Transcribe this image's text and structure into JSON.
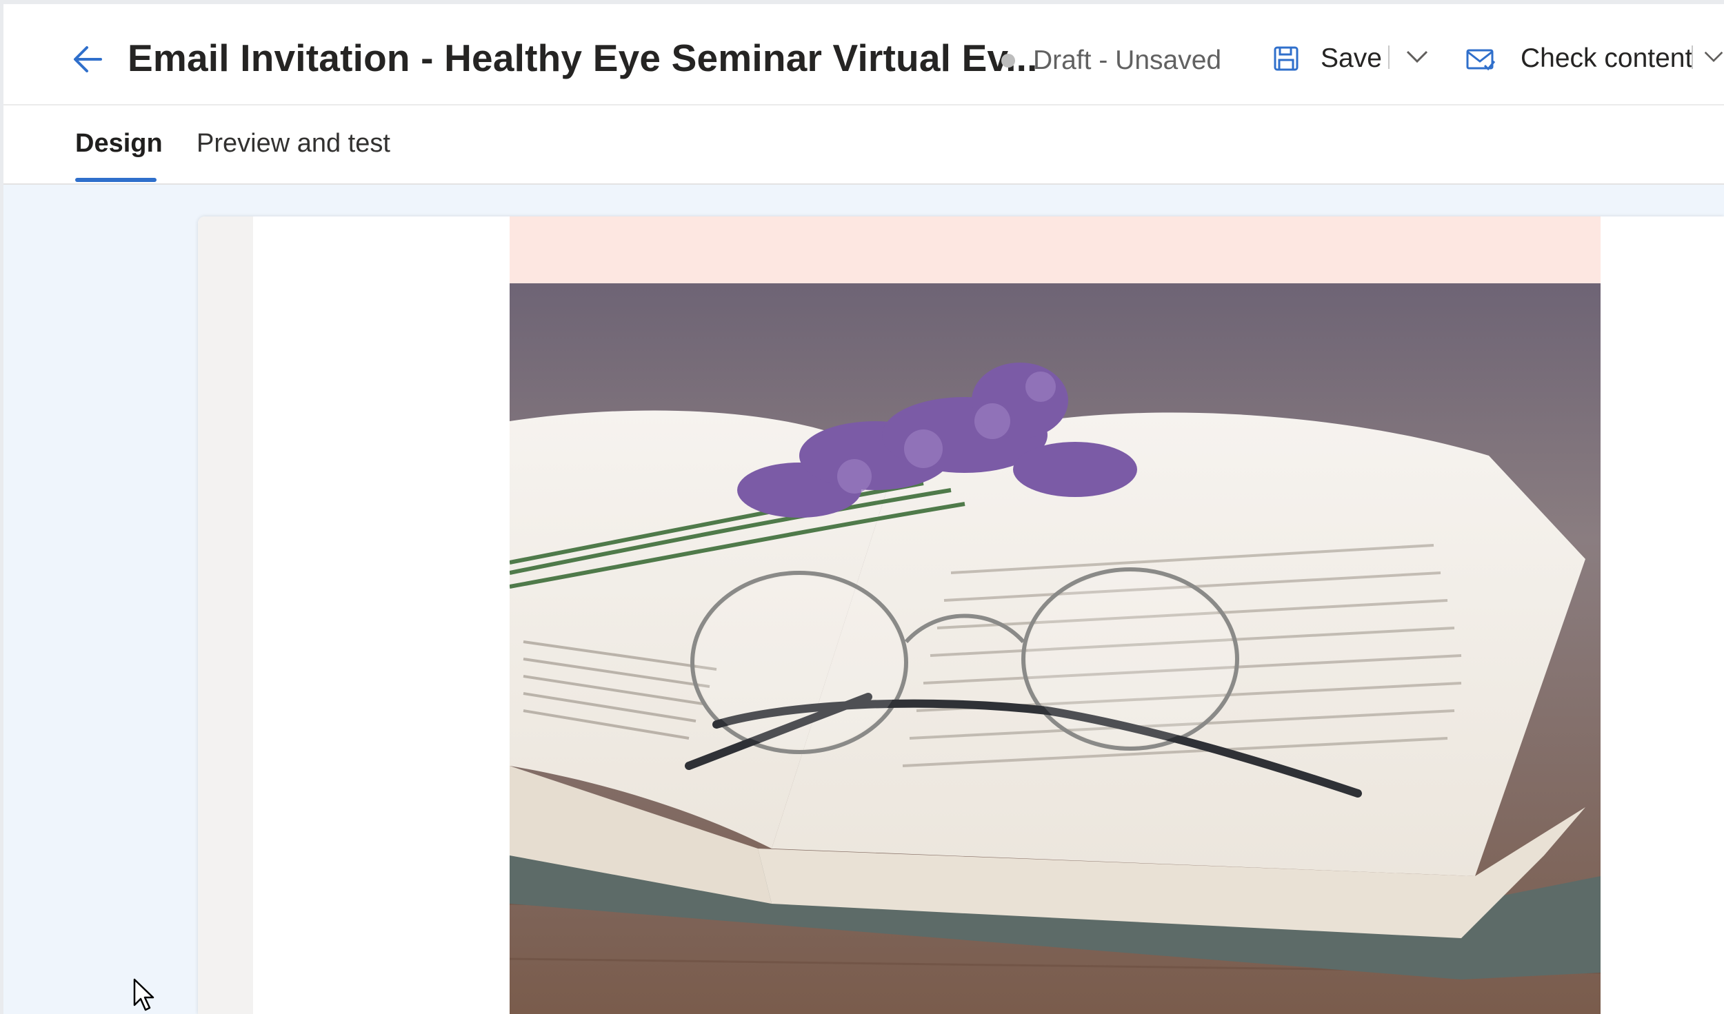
{
  "header": {
    "title": "Email Invitation - Healthy Eye Seminar Virtual Ev...",
    "status": "Draft - Unsaved",
    "save_label": "Save",
    "check_content_label": "Check content"
  },
  "tabs": [
    {
      "label": "Design",
      "active": true
    },
    {
      "label": "Preview and test",
      "active": false
    }
  ],
  "email": {
    "image_description_icon": "hero-image",
    "accent_band_color": "#fde7e1"
  },
  "colors": {
    "accent": "#2f6fcb",
    "workspace_bg": "#eff5fc"
  },
  "icons": [
    "back-arrow-icon",
    "save-icon",
    "chevron-down-icon",
    "check-content-icon",
    "mouse-cursor-icon"
  ]
}
